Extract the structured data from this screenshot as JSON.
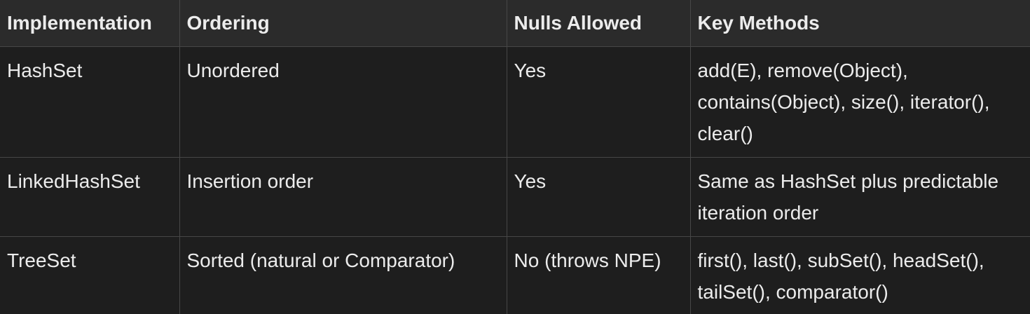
{
  "table": {
    "headers": [
      "Implementation",
      "Ordering",
      "Nulls Allowed",
      "Key Methods"
    ],
    "rows": [
      [
        "HashSet",
        "Unordered",
        "Yes",
        "add(E), remove(Object), contains(Object), size(), iterator(), clear()"
      ],
      [
        "LinkedHashSet",
        "Insertion order",
        "Yes",
        "Same as HashSet plus predictable iteration order"
      ],
      [
        "TreeSet",
        "Sorted (natural or Comparator)",
        "No (throws NPE)",
        "first(), last(), subSet(), headSet(), tailSet(), comparator()"
      ]
    ]
  }
}
